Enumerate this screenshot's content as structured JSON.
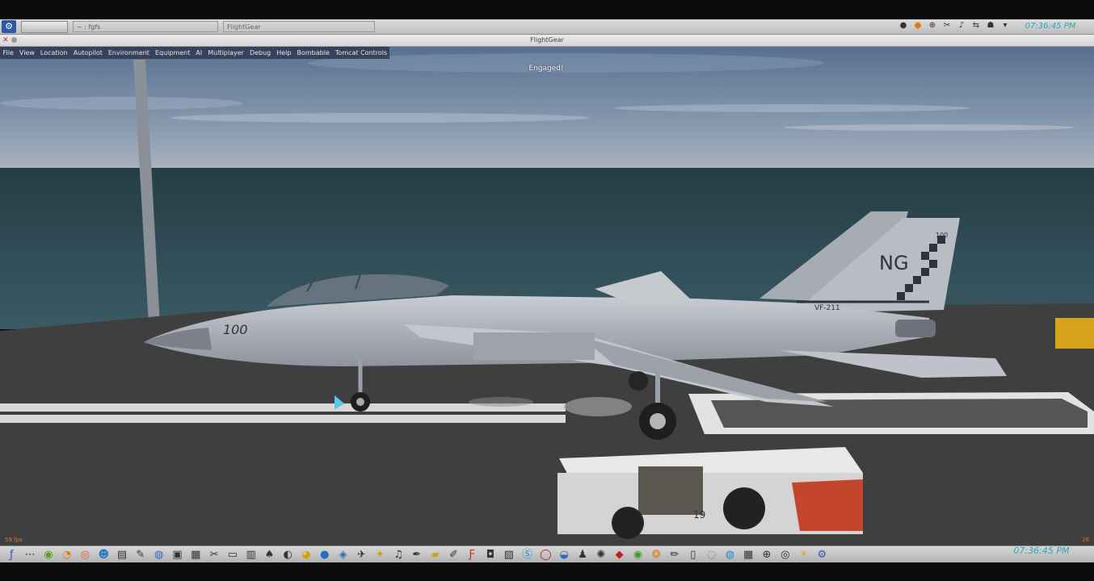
{
  "panel": {
    "task_terminal": "~ : fgfs",
    "task_flightgear": "FlightGear",
    "clock_top": "07:36:45 PM",
    "tray_icons": [
      "record-icon",
      "orange-app-icon",
      "network-icon",
      "tool-icon",
      "volume-icon",
      "share-icon",
      "tux-icon",
      "chevron-down-icon"
    ]
  },
  "window": {
    "title": "FlightGear",
    "close_glyph": "✕"
  },
  "menu": {
    "items": [
      "File",
      "View",
      "Location",
      "Autopilot",
      "Environment",
      "Equipment",
      "AI",
      "Multiplayer",
      "Debug",
      "Help",
      "Bombable",
      "Tomcat Controls"
    ]
  },
  "hud": {
    "message": "Engaged!",
    "fps": "59 fps",
    "corner_number": "28"
  },
  "aircraft": {
    "nose_number": "100",
    "tail_code": "NG",
    "squadron": "VF-211",
    "tail_number": "100",
    "tug_number": "19"
  },
  "taskbar": {
    "clock": "07:36:45 PM",
    "clock_sub": "",
    "icons": [
      "kde-menu-icon",
      "dots-icon",
      "nvidia-icon",
      "blender-icon",
      "firefox-icon",
      "users-icon",
      "document-icon",
      "gimp-icon",
      "globe-icon",
      "terminal-icon",
      "mixer-icon",
      "tools-icon",
      "monitor-icon",
      "archive-icon",
      "game-icon",
      "cd-icon",
      "chat-icon",
      "kde-ball-icon",
      "blue-app-icon",
      "plane-icon",
      "rocket-icon",
      "guitar-icon",
      "pen-icon",
      "folder-icon",
      "edit-icon",
      "filezilla-icon",
      "camera-icon",
      "image-icon",
      "skype-icon",
      "opera-icon",
      "network-icon",
      "chess-icon",
      "game2-icon",
      "app-red-icon",
      "green-icon",
      "orange-icon",
      "draw-icon",
      "doc-icon",
      "speech-icon",
      "earth-icon",
      "calc-icon",
      "target-icon",
      "disk-icon",
      "sun-icon",
      "kde-logo-icon"
    ]
  },
  "colors": {
    "sky_top": "#5f7391",
    "sea": "#2e4952",
    "deck": "#3e3e3e",
    "clock": "#2aa6b6"
  }
}
